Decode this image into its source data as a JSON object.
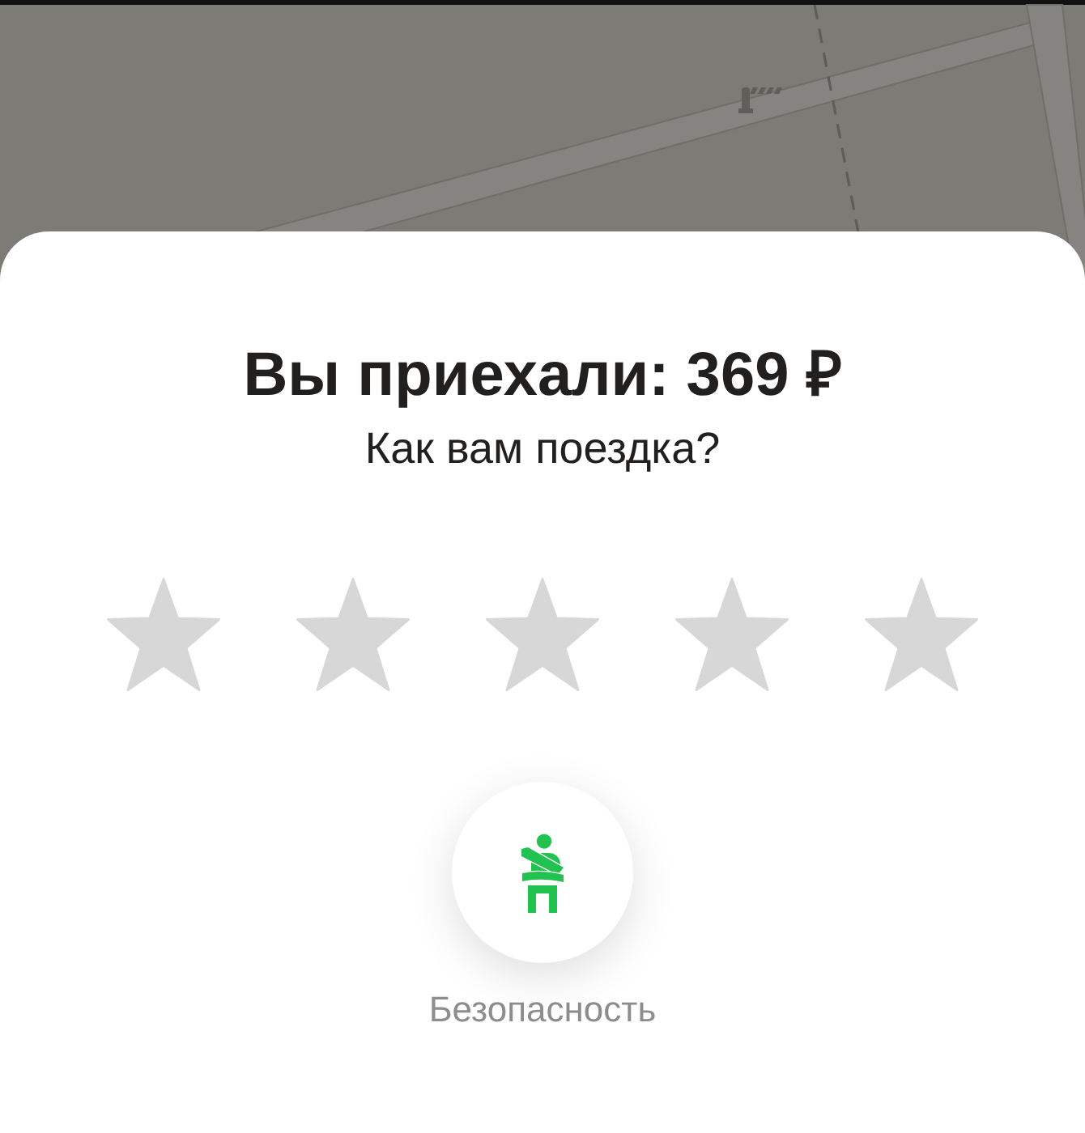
{
  "trip_summary": {
    "title": "Вы приехали: 369 ₽",
    "subtitle": "Как вам поездка?"
  },
  "rating": {
    "stars": 0
  },
  "actions": [
    {
      "kind": "safety",
      "label": "Безопасность"
    }
  ]
}
